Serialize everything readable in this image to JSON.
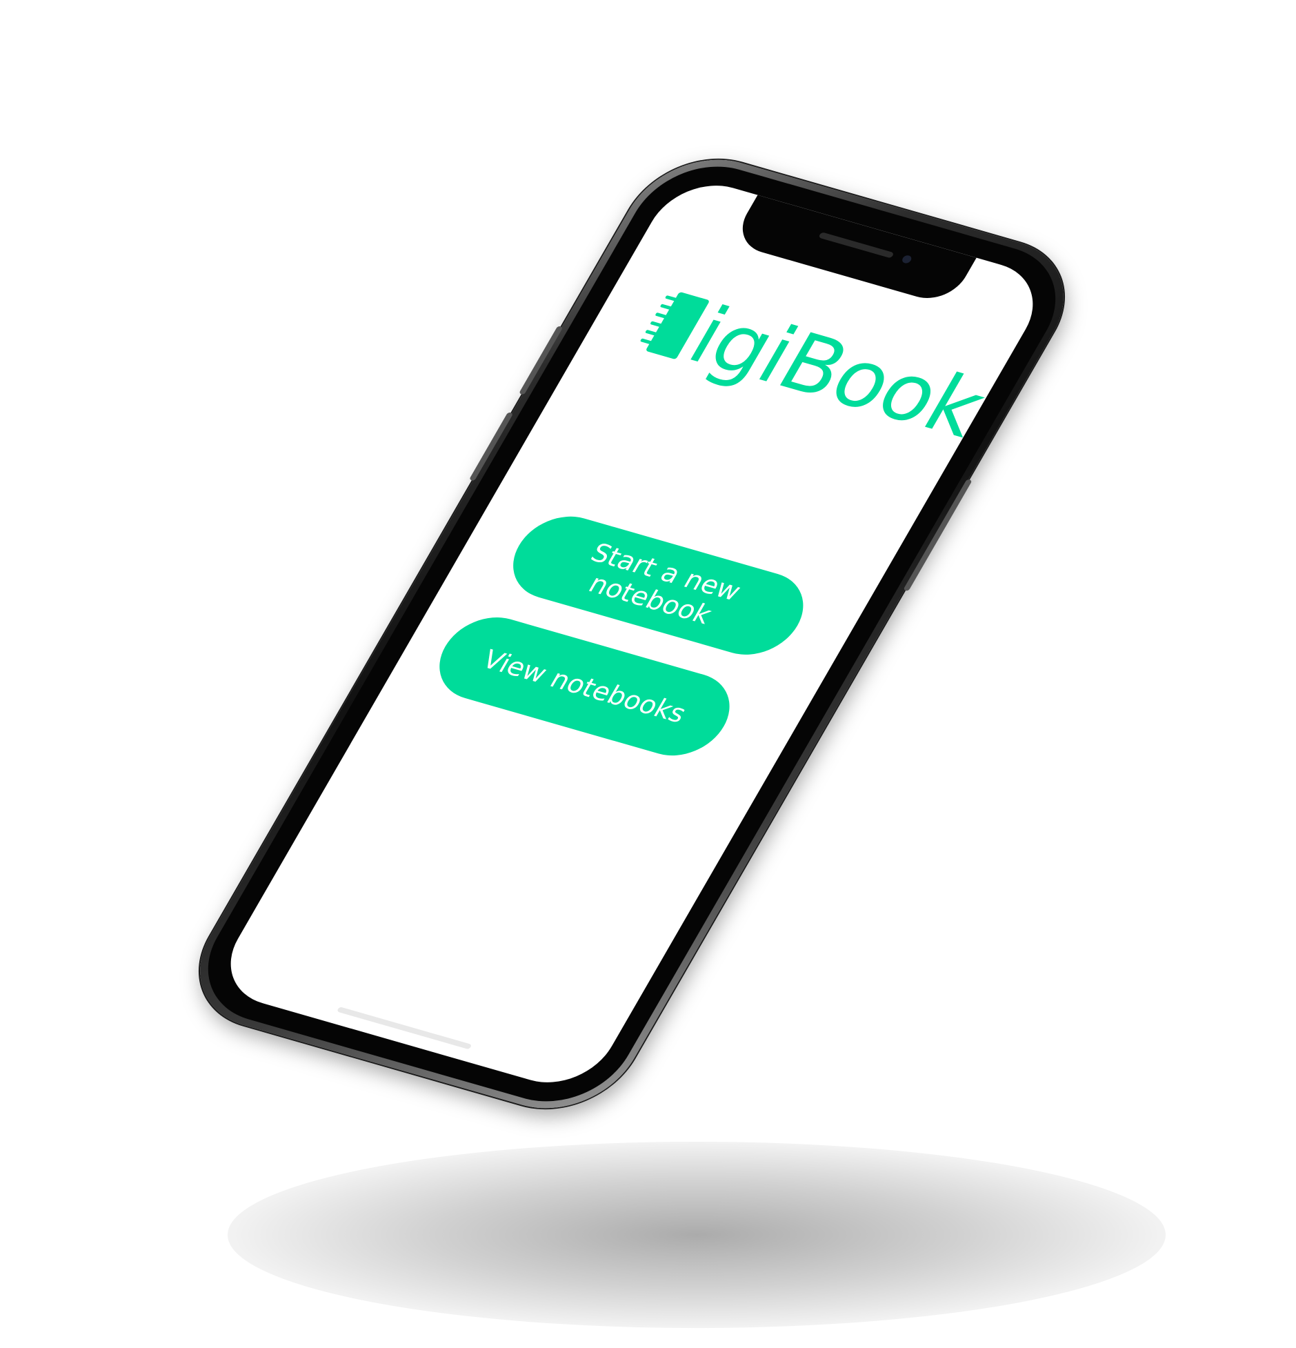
{
  "app": {
    "name": "digiBook",
    "logo_text": "igiBook",
    "accent_color": "#00DC9A"
  },
  "main": {
    "start_button_label": "Start a new notebook",
    "view_button_label": "View notebooks"
  },
  "icons": {
    "logo_icon": "notebook-spiral-icon"
  }
}
